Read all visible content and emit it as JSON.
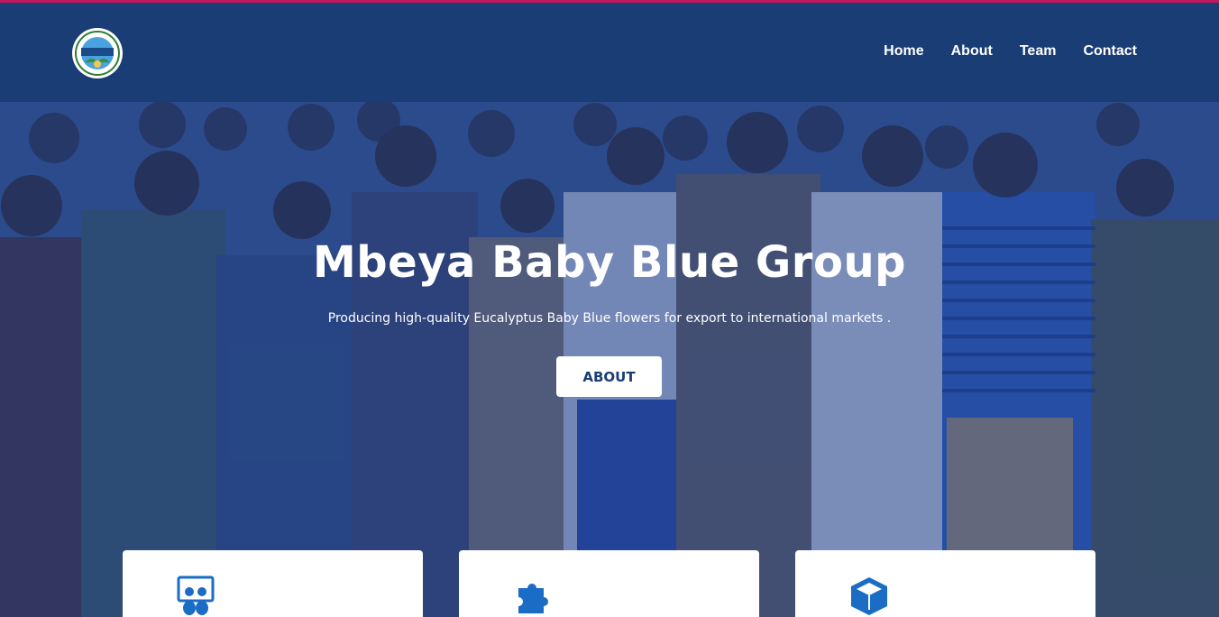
{
  "header": {
    "logo_alt": "Mbeya Baby Blue Group logo",
    "nav": [
      {
        "label": "Home"
      },
      {
        "label": "About"
      },
      {
        "label": "Team"
      },
      {
        "label": "Contact"
      }
    ]
  },
  "hero": {
    "title": "Mbeya Baby Blue Group",
    "subtitle": "Producing high-quality Eucalyptus Baby Blue flowers for export to international markets .",
    "button_label": "ABOUT"
  },
  "cards": [
    {
      "icon": "users-presentation-icon"
    },
    {
      "icon": "puzzle-icon"
    },
    {
      "icon": "box-icon"
    }
  ],
  "colors": {
    "topline": "#c2185b",
    "navbar": "#193d74",
    "overlay": "#20408c",
    "icon": "#1a6cc4"
  }
}
